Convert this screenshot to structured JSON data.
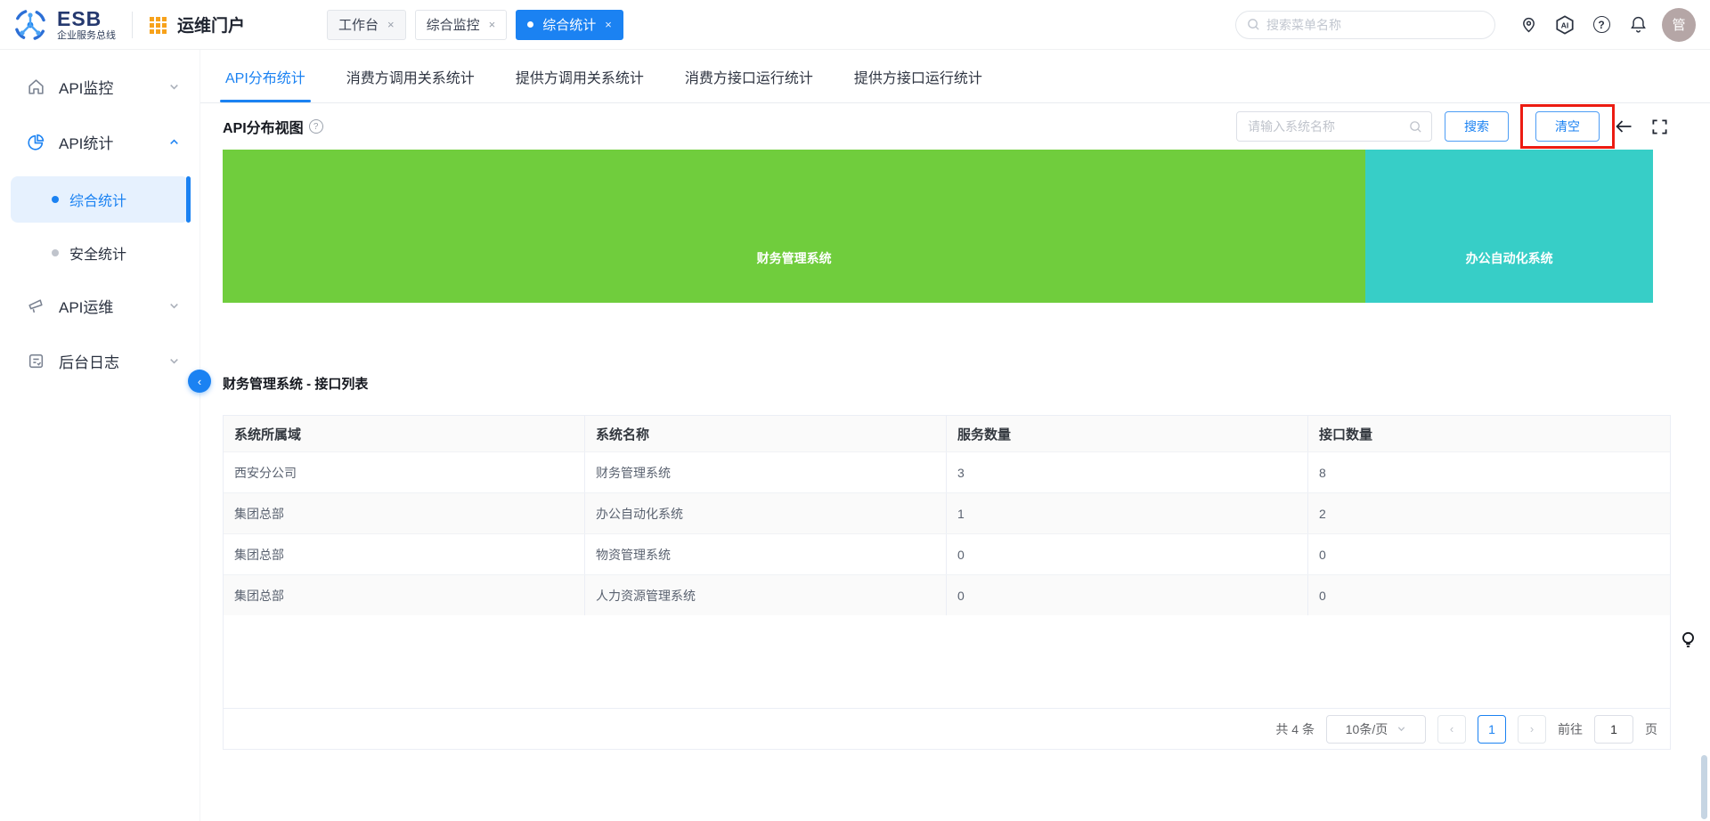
{
  "header": {
    "logo": {
      "title": "ESB",
      "subtitle": "企业服务总线"
    },
    "portal_label": "运维门户",
    "chips": [
      {
        "label": "工作台",
        "active": false
      },
      {
        "label": "综合监控",
        "active": false
      },
      {
        "label": "综合统计",
        "active": true
      }
    ],
    "chip_close": "×",
    "search_placeholder": "搜索菜单名称",
    "ai_label": "AI",
    "help_glyph": "?",
    "avatar_text": "管"
  },
  "sidebar": {
    "items": [
      {
        "label": "API监控"
      },
      {
        "label": "API统计"
      },
      {
        "label": "API运维"
      },
      {
        "label": "后台日志"
      }
    ],
    "sub_items": [
      {
        "label": "综合统计",
        "active": true
      },
      {
        "label": "安全统计",
        "active": false
      }
    ],
    "collapse_glyph": "‹"
  },
  "main": {
    "tabs": [
      {
        "label": "API分布统计",
        "active": true
      },
      {
        "label": "消费方调用关系统计",
        "active": false
      },
      {
        "label": "提供方调用关系统计",
        "active": false
      },
      {
        "label": "消费方接口运行统计",
        "active": false
      },
      {
        "label": "提供方接口运行统计",
        "active": false
      }
    ],
    "toolbar": {
      "view_title": "API分布视图",
      "search_placeholder": "请输入系统名称",
      "search_label": "搜索",
      "clear_label": "清空"
    },
    "treemap": [
      {
        "name": "财务管理系统",
        "color": "#70cd3d",
        "share_pct": 80
      },
      {
        "name": "办公自动化系统",
        "color": "#37cec7",
        "share_pct": 20
      }
    ],
    "section_title": "财务管理系统 - 接口列表",
    "table": {
      "columns": [
        "系统所属域",
        "系统名称",
        "服务数量",
        "接口数量"
      ],
      "rows": [
        [
          "西安分公司",
          "财务管理系统",
          "3",
          "8"
        ],
        [
          "集团总部",
          "办公自动化系统",
          "1",
          "2"
        ],
        [
          "集团总部",
          "物资管理系统",
          "0",
          "0"
        ],
        [
          "集团总部",
          "人力资源管理系统",
          "0",
          "0"
        ]
      ]
    },
    "pagination": {
      "total": "共 4 条",
      "page_size": "10条/页",
      "prev": "‹",
      "current_page": "1",
      "next": "›",
      "goto_label": "前往",
      "goto_value": "1",
      "page_label": "页"
    }
  },
  "colors": {
    "accent_blue": "#1b82f2",
    "treemap_green": "#70cd3d",
    "treemap_teal": "#37cec7",
    "annotation_red": "#ec1c12",
    "grid_icon_orange": "#f7a21b"
  }
}
